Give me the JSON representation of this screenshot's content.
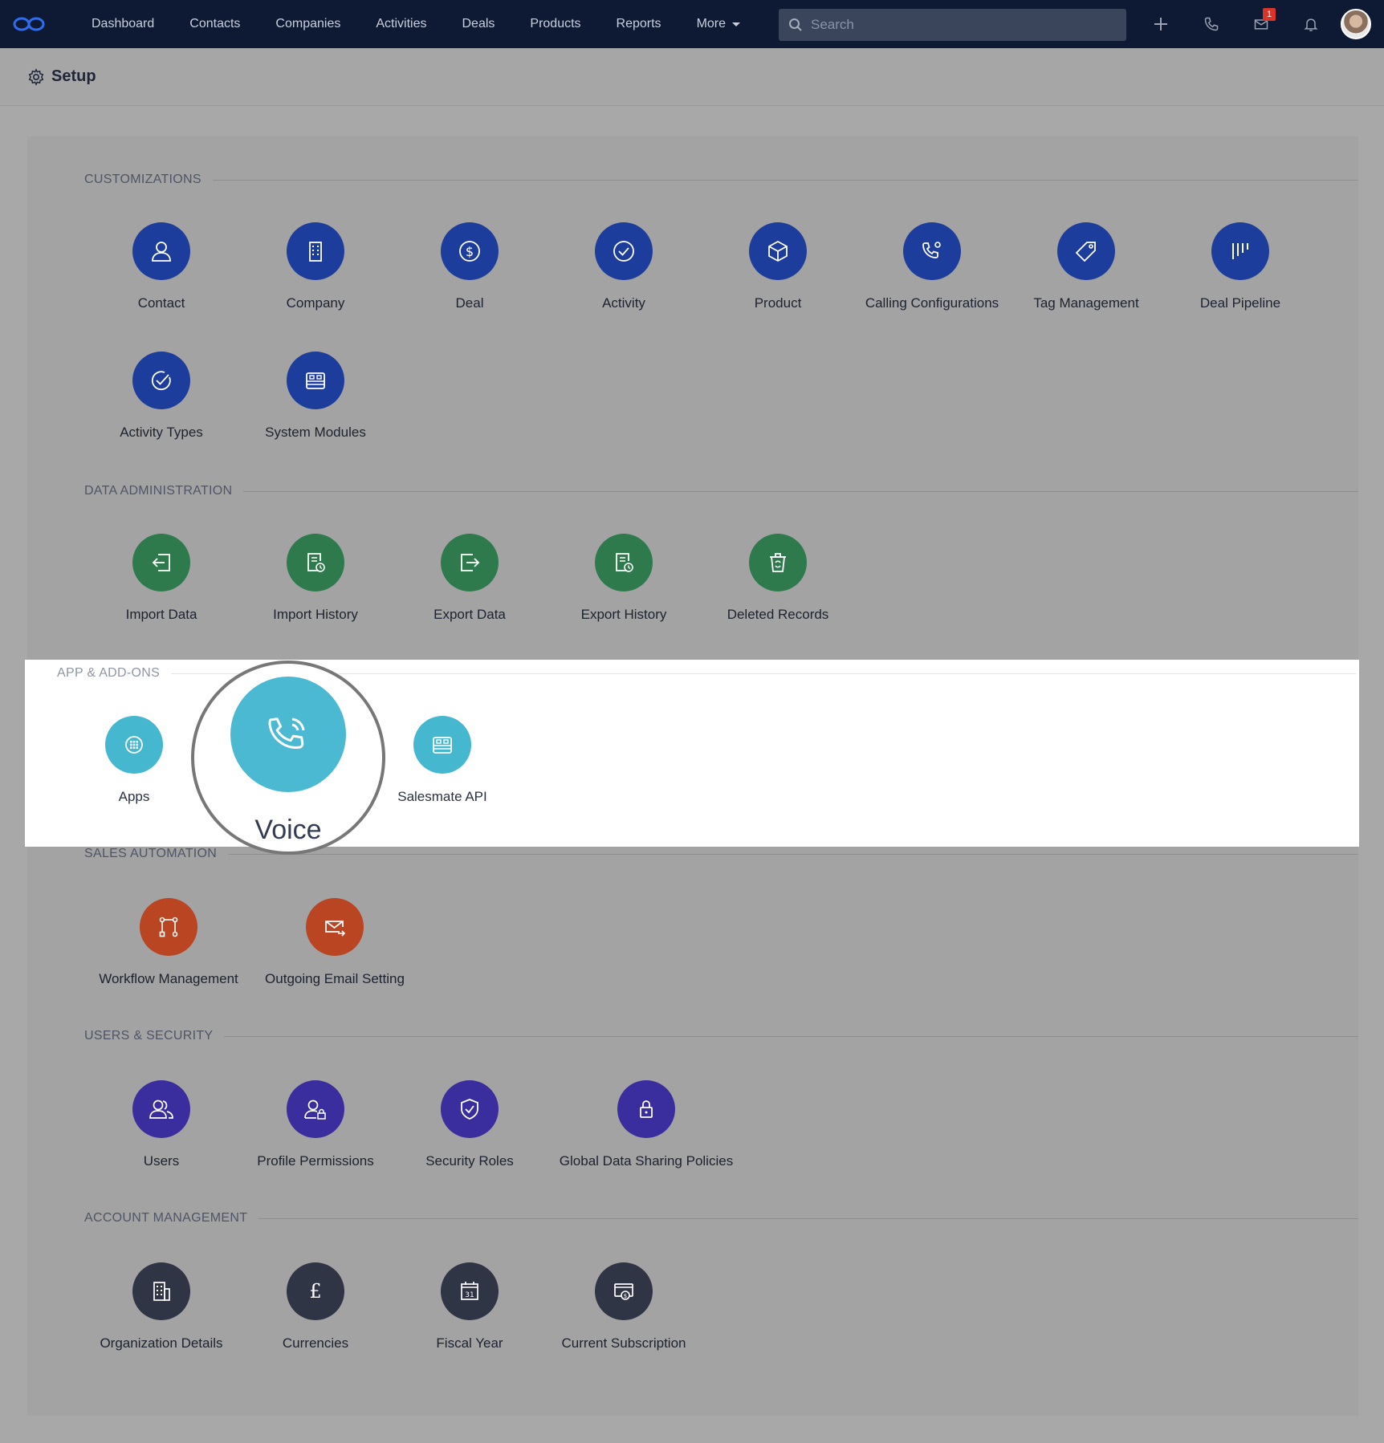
{
  "nav": {
    "items": [
      "Dashboard",
      "Contacts",
      "Companies",
      "Activities",
      "Deals",
      "Products",
      "Reports"
    ],
    "more_label": "More",
    "search_placeholder": "Search",
    "mail_badge": "1"
  },
  "setup": {
    "title": "Setup"
  },
  "sections": {
    "customizations": {
      "title": "CUSTOMIZATIONS",
      "items": [
        "Contact",
        "Company",
        "Deal",
        "Activity",
        "Product",
        "Calling Configurations",
        "Tag Management",
        "Deal Pipeline",
        "Activity Types",
        "System Modules"
      ]
    },
    "data_admin": {
      "title": "DATA ADMINISTRATION",
      "items": [
        "Import Data",
        "Import History",
        "Export Data",
        "Export History",
        "Deleted Records"
      ]
    },
    "apps": {
      "title": "APP & ADD-ONS",
      "items": [
        "Apps",
        "Voice",
        "Salesmate API"
      ]
    },
    "sales_automation": {
      "title": "SALES AUTOMATION",
      "items": [
        "Workflow Management",
        "Outgoing Email Setting"
      ]
    },
    "users_security": {
      "title": "USERS & SECURITY",
      "items": [
        "Users",
        "Profile Permissions",
        "Security Roles",
        "Global Data Sharing Policies"
      ]
    },
    "account": {
      "title": "ACCOUNT MANAGEMENT",
      "items": [
        "Organization Details",
        "Currencies",
        "Fiscal Year",
        "Current Subscription"
      ]
    }
  },
  "icons": {
    "customizations": [
      "user-icon",
      "building-icon",
      "dollar-icon",
      "check-circle-icon",
      "box-icon",
      "phone-gear-icon",
      "tag-icon",
      "pipeline-icon",
      "check-badge-icon",
      "modules-icon"
    ],
    "data_admin": [
      "import-icon",
      "history-icon",
      "export-icon",
      "history-icon",
      "recycle-bin-icon"
    ],
    "apps": [
      "apps-grid-icon",
      "phone-icon",
      "api-icon"
    ],
    "sales_automation": [
      "workflow-icon",
      "email-forward-icon"
    ],
    "users_security": [
      "users-icon",
      "user-lock-icon",
      "shield-icon",
      "lock-icon"
    ],
    "account": [
      "organization-icon",
      "pound-icon",
      "calendar-icon",
      "subscription-icon"
    ]
  },
  "colors": {
    "nav_bg": "#0e1a33",
    "customizations": "#1d3d9c",
    "data_admin": "#2f7a4c",
    "apps": "#45b7cf",
    "sales_automation": "#b94522",
    "users_security": "#3a2e9e",
    "account": "#303545"
  }
}
